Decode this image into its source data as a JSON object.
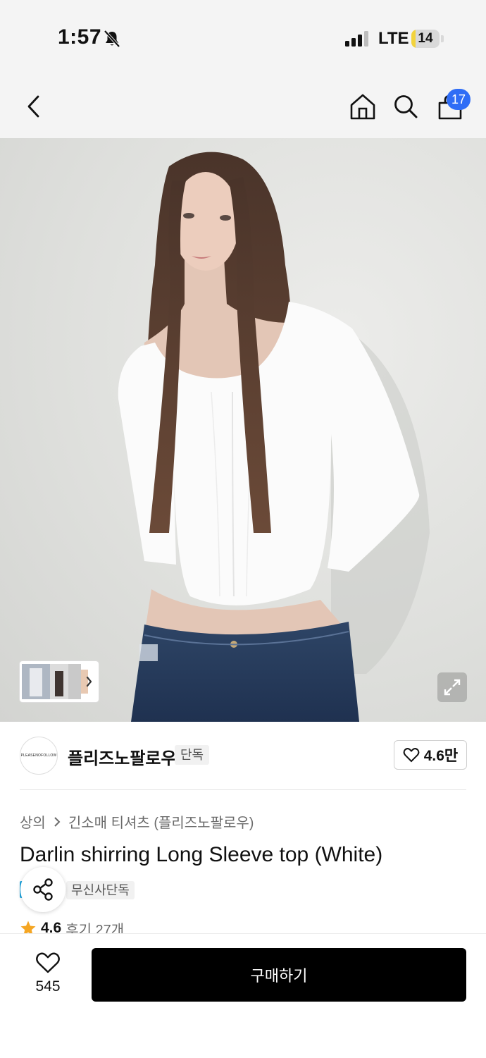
{
  "status_bar": {
    "time": "1:57",
    "network": "LTE",
    "battery_level": "14",
    "battery_fraction": 0.14
  },
  "nav": {
    "cart_count": "17",
    "icons": [
      "back-arrow-icon",
      "home-icon",
      "search-icon",
      "cart-icon"
    ]
  },
  "gallery": {
    "expand_icon": "expand-icon"
  },
  "brand": {
    "logo_text": "PLEASENOFOLLOW",
    "name": "플리즈노팔로우",
    "exclusive_label": "단독",
    "like_count": "4.6만"
  },
  "product": {
    "breadcrumb_category": "상의",
    "breadcrumb_subcategory": "긴소매 티셔츠 (플리즈노팔로우)",
    "title": "Darlin shirring Long Sleeve top (White)",
    "tag_label": "무신사단독",
    "rating": "4.6",
    "review_text": "후기 27개"
  },
  "bottom_bar": {
    "wish_count": "545",
    "buy_label": "구매하기"
  },
  "colors": {
    "accent_badge": "#2f6df6",
    "tag_blue": "#22a7e0",
    "star": "#f5a623",
    "battery": "#f2d33d"
  }
}
